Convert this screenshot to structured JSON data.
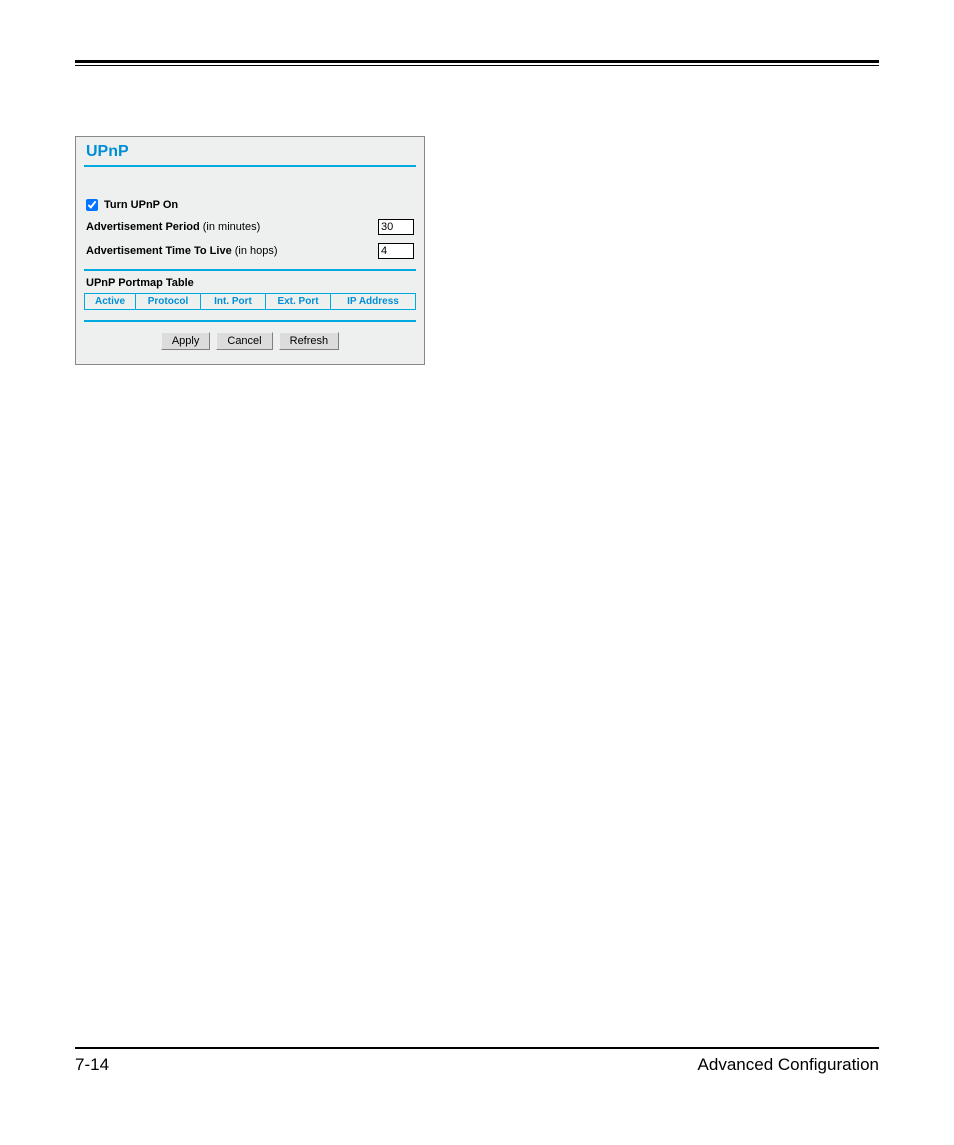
{
  "panel": {
    "title": "UPnP",
    "turn_on_checked": true,
    "turn_on_label": "Turn UPnP On",
    "ad_period_label": "Advertisement Period",
    "ad_period_unit": "(in minutes)",
    "ad_period_value": "30",
    "ttl_label": "Advertisement Time To Live",
    "ttl_unit": "(in hops)",
    "ttl_value": "4",
    "portmap_table_label": "UPnP Portmap Table",
    "headers": {
      "active": "Active",
      "protocol": "Protocol",
      "int_port": "Int. Port",
      "ext_port": "Ext. Port",
      "ip_address": "IP Address"
    },
    "buttons": {
      "apply": "Apply",
      "cancel": "Cancel",
      "refresh": "Refresh"
    }
  },
  "footer": {
    "page_number": "7-14",
    "section_title": "Advanced Configuration"
  }
}
